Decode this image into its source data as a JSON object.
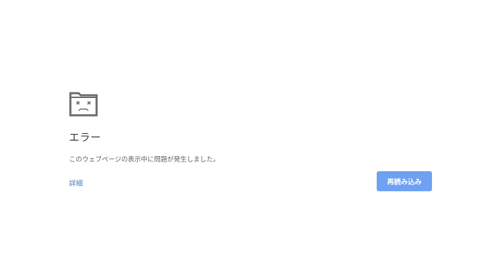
{
  "error": {
    "icon": "sad-tab-icon",
    "title": "エラー",
    "message": "このウェブページの表示中に問題が発生しました。",
    "details_link": "詳細",
    "reload_button": "再読み込み"
  },
  "colors": {
    "background": "#ffffff",
    "title": "#333333",
    "message": "#646464",
    "link": "#4a7fc1",
    "button": "#6ea1f1",
    "button_text": "#ffffff",
    "icon": "#6b6b6b"
  }
}
